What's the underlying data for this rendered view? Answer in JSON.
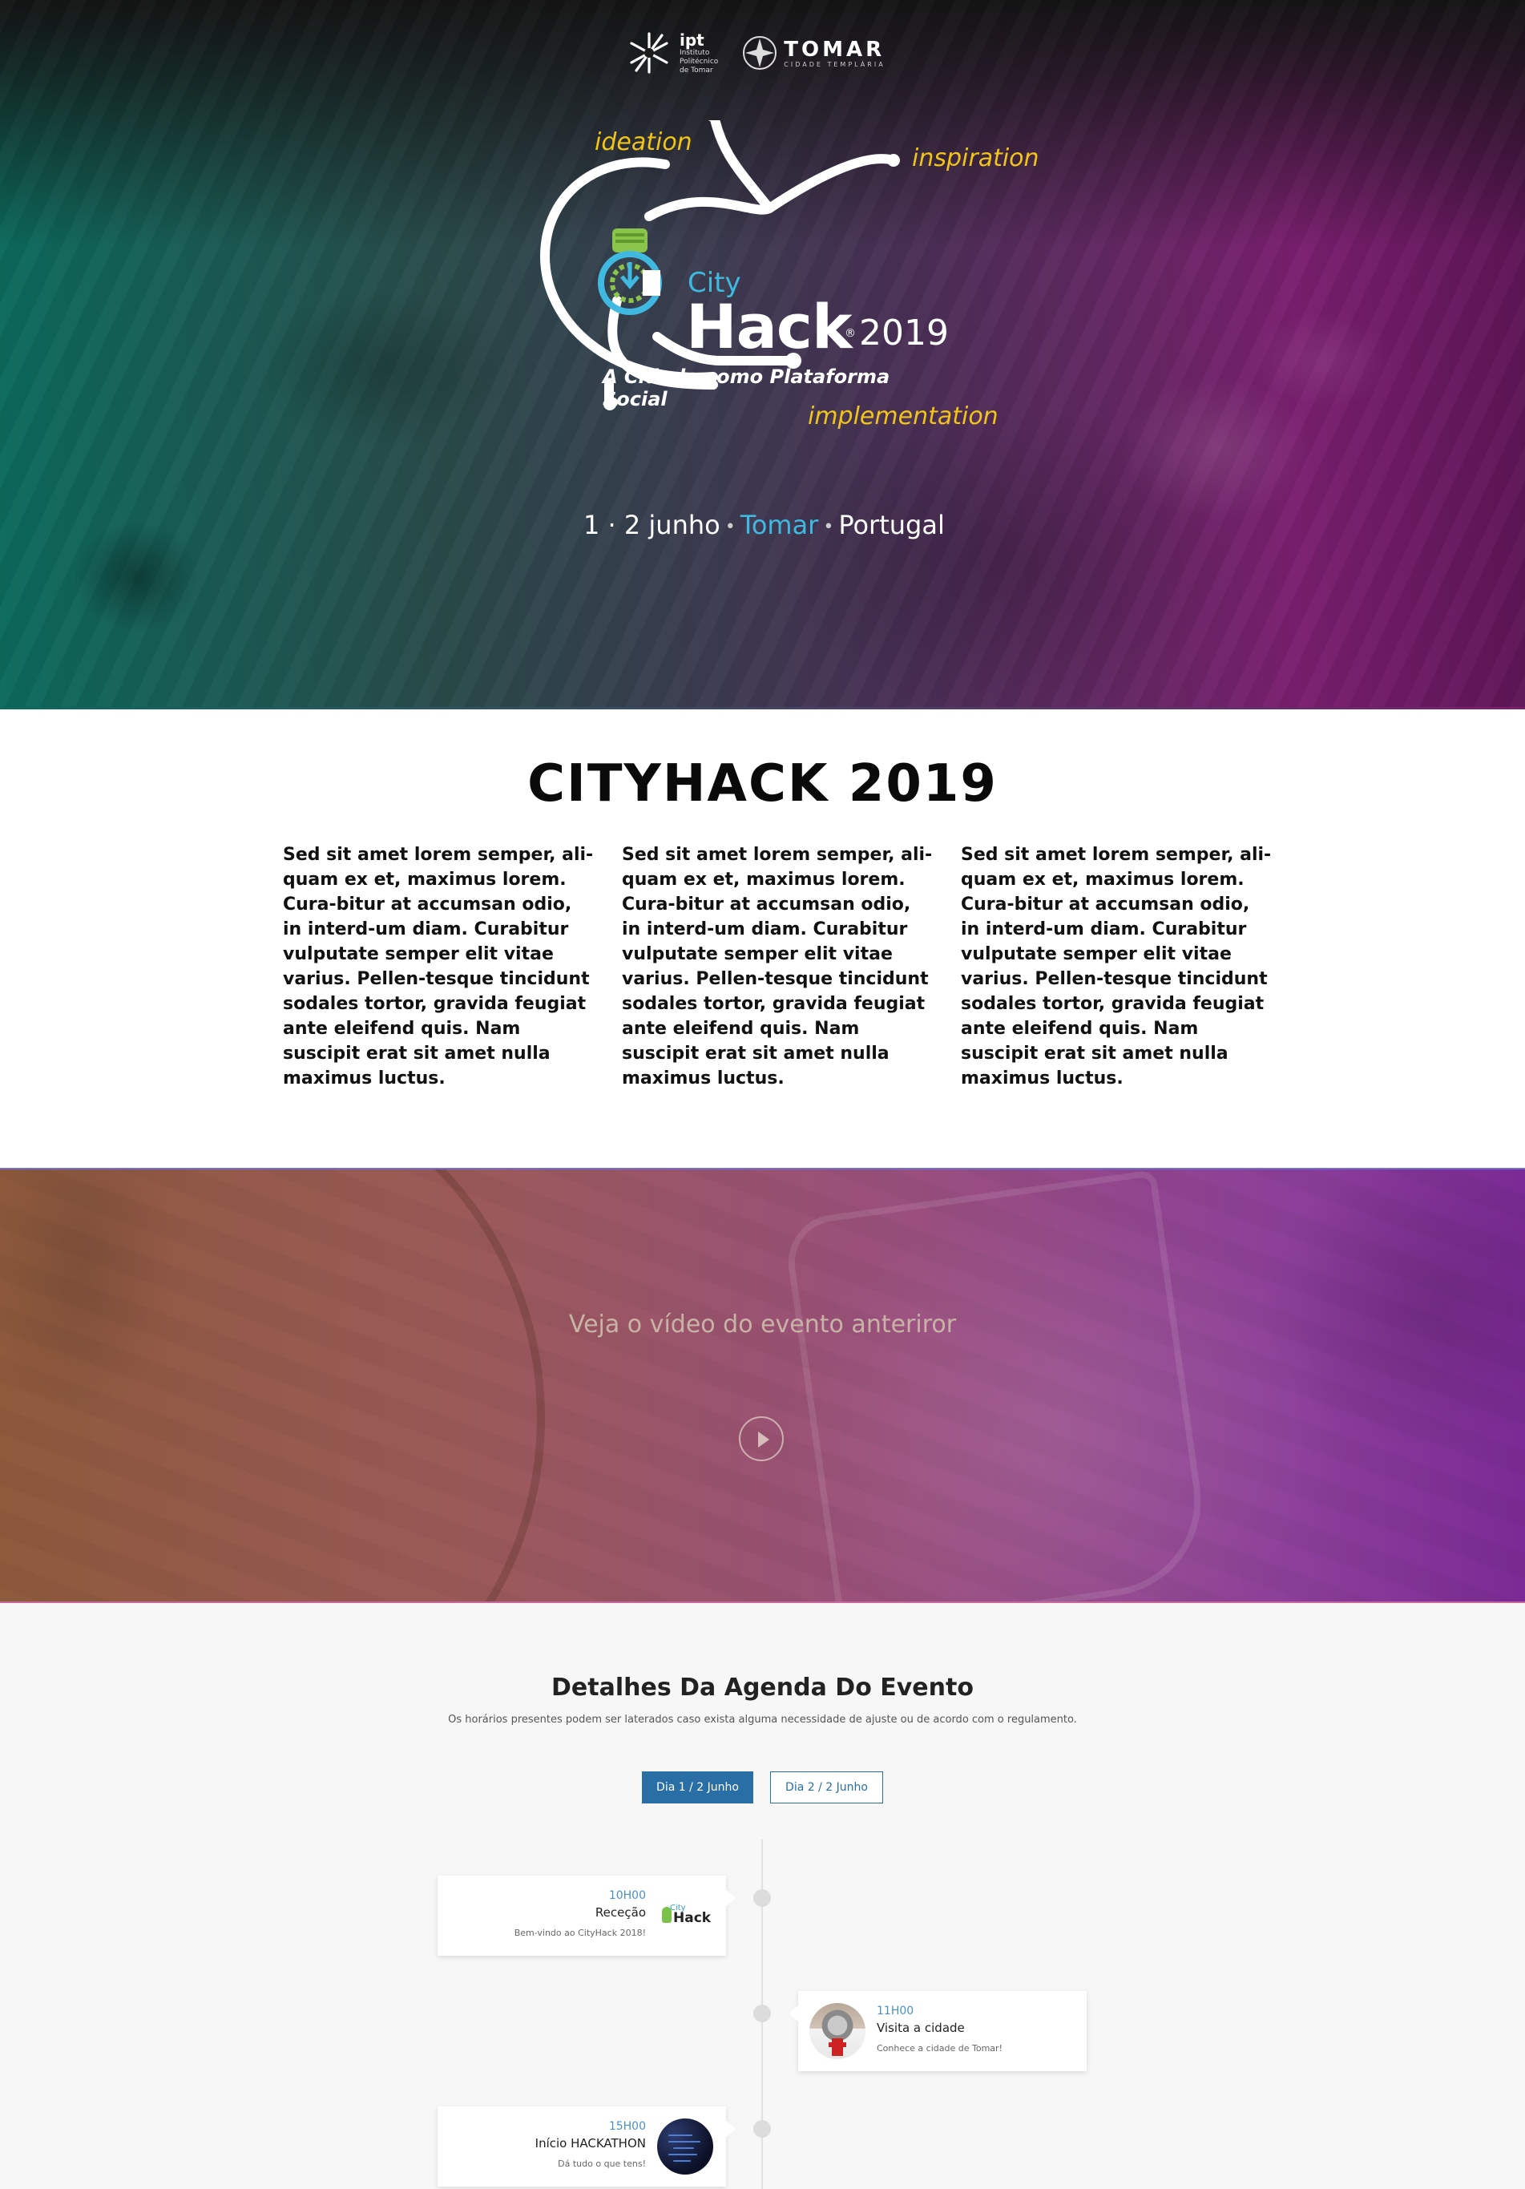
{
  "header": {
    "ipt": {
      "short": "ipt",
      "long_lines": [
        "Instituto",
        "Politécnico",
        "de Tomar"
      ]
    },
    "tomar": {
      "name": "TOMAR",
      "subtitle": "CIDADE TEMPLÁRIA"
    }
  },
  "hero": {
    "words": {
      "ideation": "ideation",
      "inspiration": "inspiration",
      "implementation": "implementation"
    },
    "brand": {
      "city": "City",
      "hack": "Hack",
      "year": "2019",
      "reg": "®"
    },
    "tagline": "A Cidade como Plataforma Social",
    "date": {
      "days": "1 · 2 junho",
      "city": "Tomar",
      "country": "Portugal"
    },
    "colors": {
      "accent_yellow": "#f0c419",
      "accent_blue": "#3fb9e0"
    }
  },
  "about": {
    "title": "CITYHACK 2019",
    "columns": [
      "Sed sit amet lorem semper, ali-quam ex et, maximus lorem. Cura-bitur at accumsan odio, in interd-um diam. Curabitur vulputate semper elit vitae varius. Pellen-tesque tincidunt sodales tortor, gravida feugiat ante eleifend quis. Nam suscipit erat sit amet nulla maximus luctus.",
      "Sed sit amet lorem semper, ali-quam ex et, maximus lorem. Cura-bitur at accumsan odio, in interd-um diam. Curabitur vulputate semper elit vitae varius. Pellen-tesque tincidunt sodales tortor, gravida feugiat ante eleifend quis. Nam suscipit erat sit amet nulla maximus luctus.",
      "Sed sit amet lorem semper, ali-quam ex et, maximus lorem. Cura-bitur at accumsan odio, in interd-um diam. Curabitur vulputate semper elit vitae varius. Pellen-tesque tincidunt sodales tortor, gravida feugiat ante eleifend quis. Nam suscipit erat sit amet nulla maximus luctus."
    ]
  },
  "video": {
    "text": "Veja o vídeo do evento anteriror",
    "play_icon": "play-icon"
  },
  "agenda": {
    "title": "Detalhes Da Agenda Do Evento",
    "subtitle": "Os horários presentes podem ser laterados caso exista alguma necessidade de ajuste ou de acordo com o regulamento.",
    "tabs": [
      "Dia 1 / 2 Junho",
      "Dia 2 / 2 Junho"
    ],
    "active_tab": 0,
    "events": [
      {
        "time": "10H00",
        "title": "Receção",
        "desc": "Bem-vindo ao CityHack 2018!",
        "thumb": "cityhack-logo",
        "side": "left"
      },
      {
        "time": "11H00",
        "title": "Visita a cidade",
        "desc": "Conhece a cidade de Tomar!",
        "thumb": "templar-knight-photo",
        "side": "right"
      },
      {
        "time": "15H00",
        "title": "Início HACKATHON",
        "desc": "Dá tudo o que tens!",
        "thumb": "code-screen-photo",
        "side": "left"
      }
    ],
    "thumb_mini": {
      "city": "City",
      "hack": "Hack"
    }
  }
}
